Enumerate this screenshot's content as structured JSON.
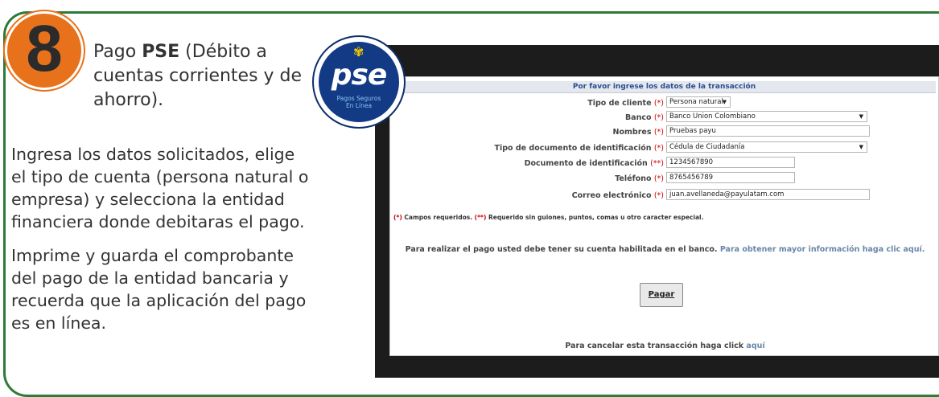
{
  "step": {
    "number": "8",
    "title_prefix": "Pago ",
    "title_bold": "PSE",
    "title_suffix": " (Débito a cuentas corrientes y de ahorro).",
    "paragraph_1": "Ingresa los datos solicitados, elige el tipo de cuenta (persona natural o empresa) y selecciona la entidad financiera donde debitaras el pago.",
    "paragraph_2": "Imprime y guarda el comprobante del pago de la entidad bancaria  y recuerda que la aplicación del pago es en línea."
  },
  "logo": {
    "word": "pse",
    "subtitle_1": "Pagos Seguros",
    "subtitle_2": "En Línea"
  },
  "form": {
    "header": "Por favor ingrese los datos de la transacción",
    "required_mark": "(*)",
    "required_mark_special": "(**)",
    "fields": {
      "client_type": {
        "label": "Tipo de cliente",
        "value": "Persona natural"
      },
      "bank": {
        "label": "Banco",
        "value": "Banco Union Colombiano"
      },
      "names": {
        "label": "Nombres",
        "value": "Pruebas payu"
      },
      "doc_type": {
        "label": "Tipo de documento de identificación",
        "value": "Cédula de Ciudadanía"
      },
      "doc_number": {
        "label": "Documento de identificación",
        "value": "1234567890"
      },
      "phone": {
        "label": "Teléfono",
        "value": "8765456789"
      },
      "email": {
        "label": "Correo electrónico",
        "value": "juan.avellaneda@payulatam.com"
      }
    },
    "note_required": " Campos requeridos. ",
    "note_special": " Requerido sin guiones, puntos, comas u otro caracter especial.",
    "info_text": "Para realizar el pago usted debe tener su cuenta habilitada en el banco.",
    "info_link": "Para obtener mayor información haga clic aquí.",
    "pay_button": "Pagar",
    "cancel_text": "Para cancelar esta transacción haga click ",
    "cancel_link": "aquí"
  },
  "colors": {
    "frame_green": "#2e7a38",
    "step_orange": "#e8721c",
    "pse_blue": "#123a85",
    "header_blue": "#2a4d8e",
    "required_red": "#d00000"
  }
}
